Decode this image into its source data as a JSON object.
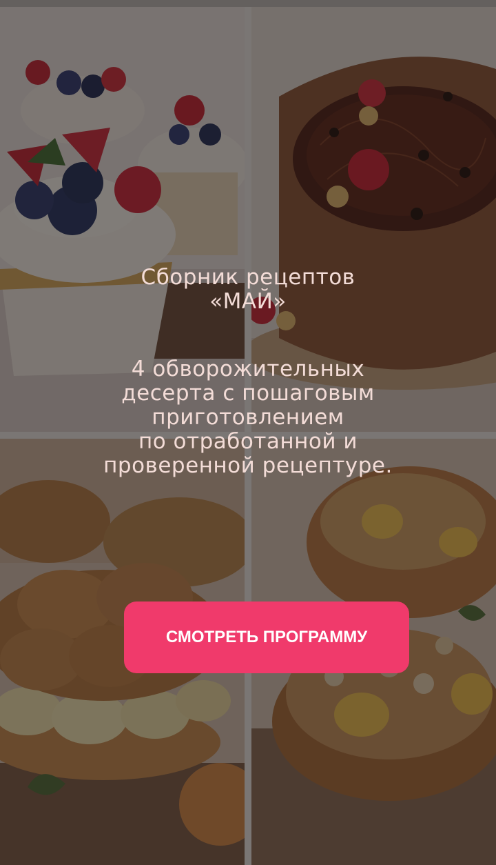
{
  "promo": {
    "title_line_1": "Сборник рецептов",
    "title_line_2": "«МАЙ»",
    "description_line_1": "4 обворожительных",
    "description_line_2": "десерта с пошаговым",
    "description_line_3": "приготовлением",
    "description_line_4": "по отработанной и",
    "description_line_5": "проверенной рецептуре."
  },
  "cta": {
    "label": "СМОТРЕТЬ ПРОГРАММУ"
  },
  "colors": {
    "accent": "#f03a6b",
    "hero_text": "#f3dcd7",
    "overlay": "rgba(28,22,22,0.55)"
  },
  "images": [
    {
      "subject": "cupcakes-with-berries"
    },
    {
      "subject": "chocolate-cake"
    },
    {
      "subject": "cream-pastry"
    },
    {
      "subject": "crumble-tart"
    }
  ]
}
